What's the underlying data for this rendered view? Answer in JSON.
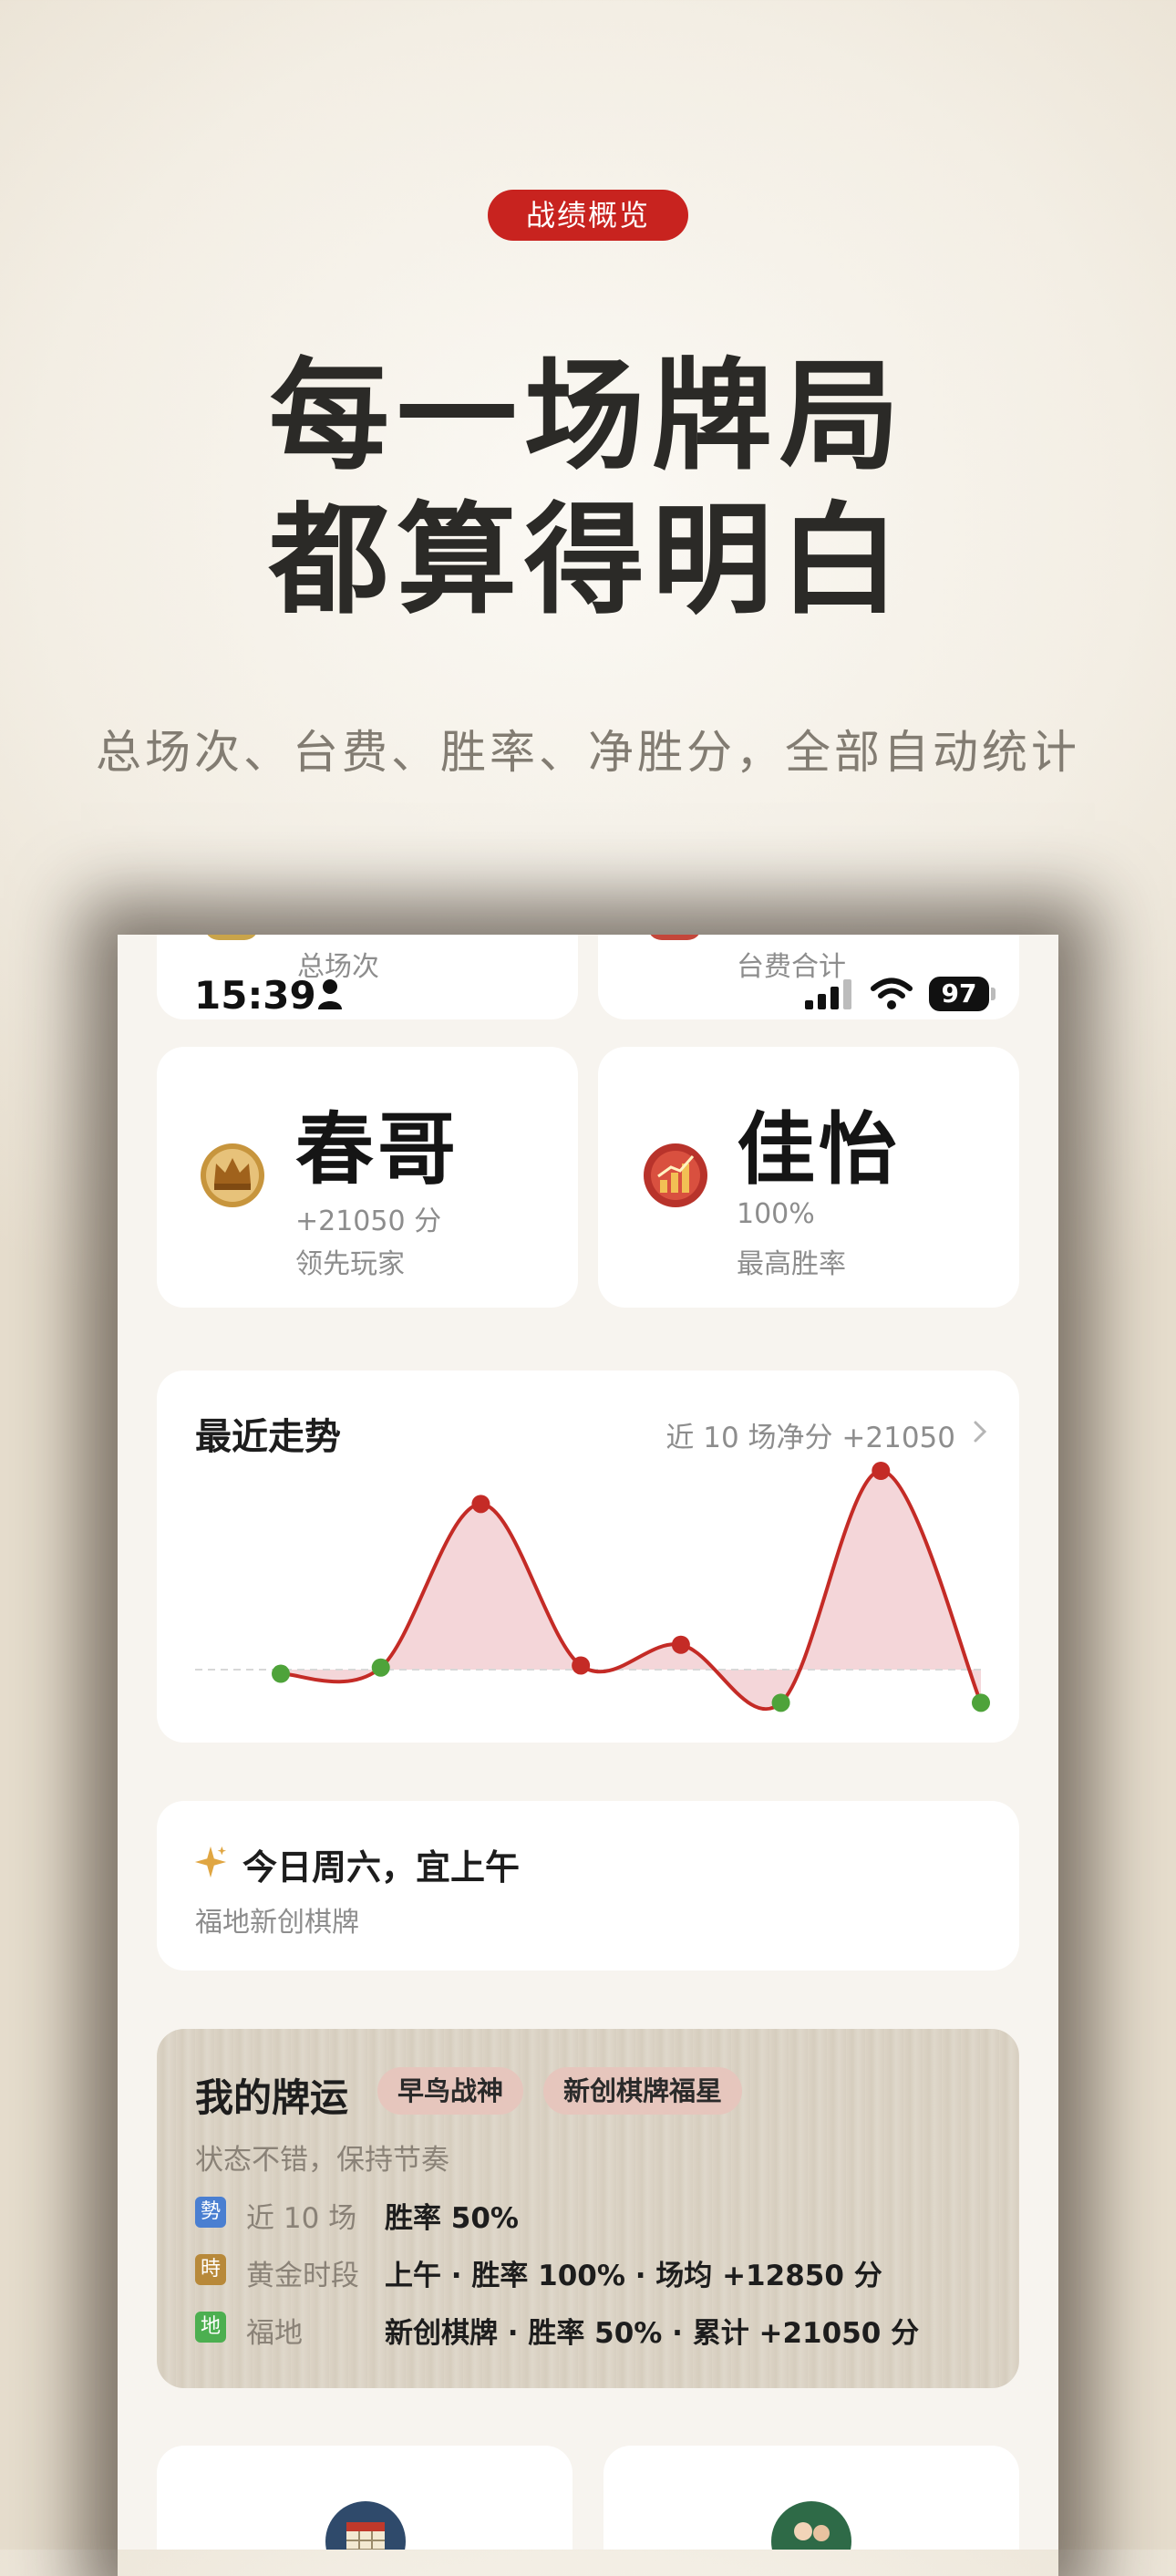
{
  "hero": {
    "badge": "战绩概览",
    "title_line1": "每一场牌局",
    "title_line2": "都算得明白",
    "subtitle": "总场次、台费、胜率、净胜分，全部自动统计"
  },
  "status_bar": {
    "time": "15:39",
    "battery": "97"
  },
  "top_stats": {
    "left_label": "总场次",
    "right_label": "台费合计"
  },
  "players": [
    {
      "name": "春哥",
      "score": "+21050 分",
      "role": "领先玩家",
      "icon": "crown-medal-icon"
    },
    {
      "name": "佳怡",
      "score": "100%",
      "role": "最高胜率",
      "icon": "chart-medal-icon"
    }
  ],
  "trend": {
    "title": "最近走势",
    "summary": "近 10 场净分 +21050",
    "colors": {
      "line": "#c42b26",
      "fill": "#f2cfd2",
      "up": "#c42b26",
      "down": "#4ea33a",
      "baseline": "#d8d8d8"
    }
  },
  "chart_data": {
    "type": "line",
    "series": [
      {
        "values": [
          -10,
          5,
          400,
          10,
          60,
          -80,
          480,
          -80
        ],
        "point_status": [
          "down",
          "down",
          "up",
          "up",
          "up",
          "down",
          "up",
          "down"
        ]
      }
    ],
    "grid": false
  },
  "tip": {
    "title": "今日周六，宜上午",
    "subtitle": "福地新创棋牌",
    "icon": "sparkle-icon"
  },
  "luck": {
    "title": "我的牌运",
    "tags": [
      "早鸟战神",
      "新创棋牌福星"
    ],
    "subtitle": "状态不错，保持节奏",
    "rows": [
      {
        "icon_char": "勢",
        "icon_color": "#4a7fd1",
        "label": "近 10 场",
        "value": "胜率 50%"
      },
      {
        "icon_char": "時",
        "icon_color": "#b8893a",
        "label": "黄金时段",
        "value": "上午 · 胜率 100% · 场均 +12850 分"
      },
      {
        "icon_char": "地",
        "icon_color": "#4caf50",
        "label": "福地",
        "value": "新创棋牌 · 胜率 50% · 累计 +21050 分"
      }
    ]
  }
}
